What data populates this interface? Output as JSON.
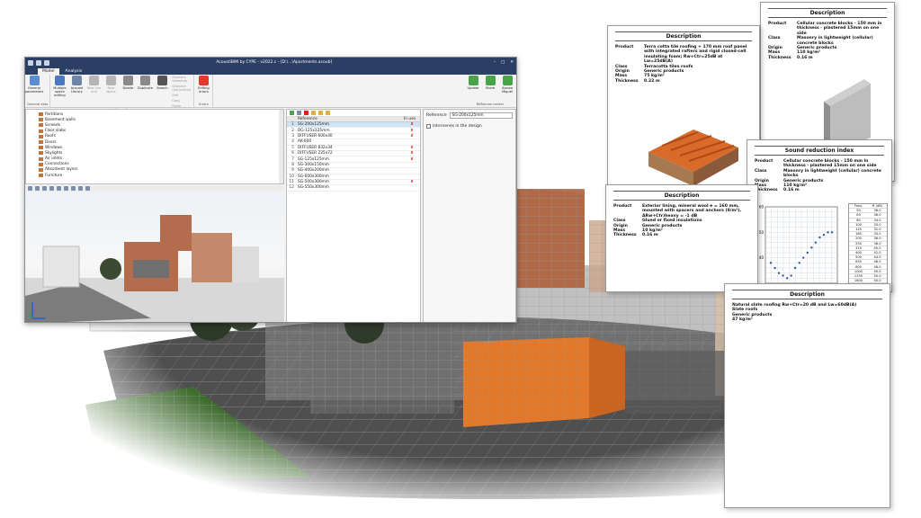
{
  "window": {
    "title": "AcoustiBIM by CYPE - v2022.c - [D:\\...\\Apartments.acoub]",
    "tabs": [
      "Model",
      "Analysis"
    ],
    "active_tab": "Model",
    "ribbon_groups": [
      {
        "label": "General data",
        "buttons": [
          {
            "label": "General parameters",
            "icon": "settings-icon",
            "color": "#5b8bd0"
          }
        ]
      },
      {
        "label": "Use units",
        "buttons": [
          {
            "label": "Multiple space editing",
            "icon": "spaces-icon",
            "color": "#4a78c2"
          },
          {
            "label": "Acoubit Library",
            "icon": "library-icon",
            "color": "#6e86a8"
          },
          {
            "label": "New use unit",
            "icon": "new-unit-icon",
            "color": "#b5b5b5",
            "disabled": true
          },
          {
            "label": "New space",
            "icon": "new-space-icon",
            "color": "#b5b5b5",
            "disabled": true
          },
          {
            "label": "Delete",
            "icon": "delete-icon",
            "color": "#8a8a8a"
          },
          {
            "label": "Duplicate",
            "icon": "duplicate-icon",
            "color": "#8a8a8a"
          },
          {
            "label": "Search",
            "icon": "search-icon",
            "color": "#555555"
          }
        ],
        "small": [
          "Displace elements",
          "Displace (horizontal)",
          "Edit",
          "Copy",
          "Paste"
        ]
      },
      {
        "label": "Errors",
        "buttons": [
          {
            "label": "Editing errors",
            "icon": "error-icon",
            "color": "#e23a2a"
          }
        ]
      },
      {
        "label": "BIMserver.center",
        "buttons": [
          {
            "label": "Update",
            "icon": "update-icon",
            "color": "#4aa24a"
          },
          {
            "label": "Share",
            "icon": "share-icon",
            "color": "#4aa24a"
          },
          {
            "label": "Alonso Miguel",
            "icon": "user-icon",
            "color": "#4aa24a"
          }
        ]
      }
    ],
    "tree_items": [
      "Partitions",
      "Basement walls",
      "Screeds",
      "Floor slabs",
      "Roofs",
      "Doors",
      "Windows",
      "Skylights",
      "Air inlets",
      "Connections",
      "Absorbent layers",
      "Furniture"
    ],
    "table": {
      "headers": [
        "Reference",
        "In use"
      ],
      "rows": [
        {
          "n": "1",
          "ref": "SG-200x125mm",
          "x": "✘"
        },
        {
          "n": "2",
          "ref": "DG-125x125mm",
          "x": "✘"
        },
        {
          "n": "3",
          "ref": "DIFFUSER 600x40",
          "x": "✘"
        },
        {
          "n": "4",
          "ref": "AK-600",
          "x": ""
        },
        {
          "n": "5",
          "ref": "DIFFUSER 832x34",
          "x": "✘"
        },
        {
          "n": "6",
          "ref": "DIFFUSER 225x72",
          "x": "✘"
        },
        {
          "n": "7",
          "ref": "SG-125x125mm",
          "x": "✘"
        },
        {
          "n": "8",
          "ref": "SG-300x150mm",
          "x": ""
        },
        {
          "n": "9",
          "ref": "SG-400x200mm",
          "x": ""
        },
        {
          "n": "10",
          "ref": "SG-600x300mm",
          "x": ""
        },
        {
          "n": "11",
          "ref": "SG-500x300mm",
          "x": "✘"
        },
        {
          "n": "12",
          "ref": "SG-550x300mm",
          "x": ""
        }
      ]
    },
    "detail": {
      "reference_label": "Reference",
      "reference_value": "SG-200x125mm",
      "checkbox_label": "Intervenes in the design"
    }
  },
  "sheets": {
    "roof": {
      "title": "Description",
      "rows": [
        {
          "k": "Product",
          "v": "Terra cotta tile roofing + 170 mm roof panel with integrated rafters and rigid closed-cell insulating foam; Rw+Ctr=25dB at Lw=25dB(A)"
        },
        {
          "k": "Class",
          "v": "Terracotta tiles roofs"
        },
        {
          "k": "Origin",
          "v": "Generic products"
        },
        {
          "k": "Mass",
          "v": "75 kg/m²"
        },
        {
          "k": "Thickness",
          "v": "0.22 m"
        }
      ]
    },
    "block": {
      "title": "Description",
      "rows": [
        {
          "k": "Product",
          "v": "Cellular concrete blocks - 150 mm in thickness - plastered 15mm on one side"
        },
        {
          "k": "Class",
          "v": "Masonry in lightweight (cellular) concrete blocks"
        },
        {
          "k": "Origin",
          "v": "Generic products"
        },
        {
          "k": "Mass",
          "v": "110 kg/m²"
        },
        {
          "k": "Thickness",
          "v": "0.16 m"
        }
      ]
    },
    "sri": {
      "title": "Sound reduction index",
      "rows": [
        {
          "k": "Product",
          "v": "Cellular concrete blocks - 150 mm in thickness - plastered 15mm on one side"
        },
        {
          "k": "Class",
          "v": "Masonry in lightweight (cellular) concrete blocks"
        },
        {
          "k": "Origin",
          "v": "Generic products"
        },
        {
          "k": "Mass",
          "v": "110 kg/m²"
        },
        {
          "k": "Thickness",
          "v": "0.16 m"
        }
      ],
      "table_head": [
        "Freq.",
        "R (dB)"
      ],
      "table_rows": [
        [
          "50",
          "38.0"
        ],
        [
          "63",
          "36.0"
        ],
        [
          "80",
          "34.0"
        ],
        [
          "100",
          "33.0"
        ],
        [
          "125",
          "32.0"
        ],
        [
          "160",
          "33.0"
        ],
        [
          "200",
          "36.0"
        ],
        [
          "250",
          "38.0"
        ],
        [
          "315",
          "40.0"
        ],
        [
          "400",
          "42.0"
        ],
        [
          "500",
          "44.0"
        ],
        [
          "630",
          "46.0"
        ],
        [
          "800",
          "48.0"
        ],
        [
          "1000",
          "49.0"
        ],
        [
          "1250",
          "50.0"
        ],
        [
          "1600",
          "50.0"
        ]
      ]
    },
    "lining": {
      "title": "Description",
      "rows": [
        {
          "k": "Product",
          "v": "Exterior lining, mineral wool e = 160 mm, mounted with spacers and anchors (8/m²), ΔRw+Ctr)heavy = -1 dB"
        },
        {
          "k": "Class",
          "v": "Glued or fixed insulations"
        },
        {
          "k": "Origin",
          "v": "Generic products"
        },
        {
          "k": "Mass",
          "v": "10 kg/m²"
        },
        {
          "k": "Thickness",
          "v": "0.16 m"
        }
      ]
    },
    "slate": {
      "title": "Description",
      "rows": [
        {
          "k": "",
          "v": "Natural slate roofing Rw+Ctr=20 dB and Lw=60dB(A)"
        },
        {
          "k": "",
          "v": "Slate roofs"
        },
        {
          "k": "",
          "v": "Generic products"
        },
        {
          "k": "",
          "v": "47 kg/m²"
        }
      ]
    }
  },
  "chart_data": {
    "type": "scatter",
    "title": "",
    "xlabel": "",
    "ylabel": "",
    "x": [
      50,
      63,
      80,
      100,
      125,
      160,
      200,
      250,
      315,
      400,
      500,
      630,
      800,
      1000,
      1250,
      1600
    ],
    "y": [
      38,
      36,
      34,
      33,
      32,
      33,
      36,
      38,
      40,
      42,
      44,
      46,
      48,
      49,
      50,
      50
    ],
    "ylim": [
      30,
      60
    ],
    "yticks": [
      "60",
      "50",
      "40"
    ]
  }
}
